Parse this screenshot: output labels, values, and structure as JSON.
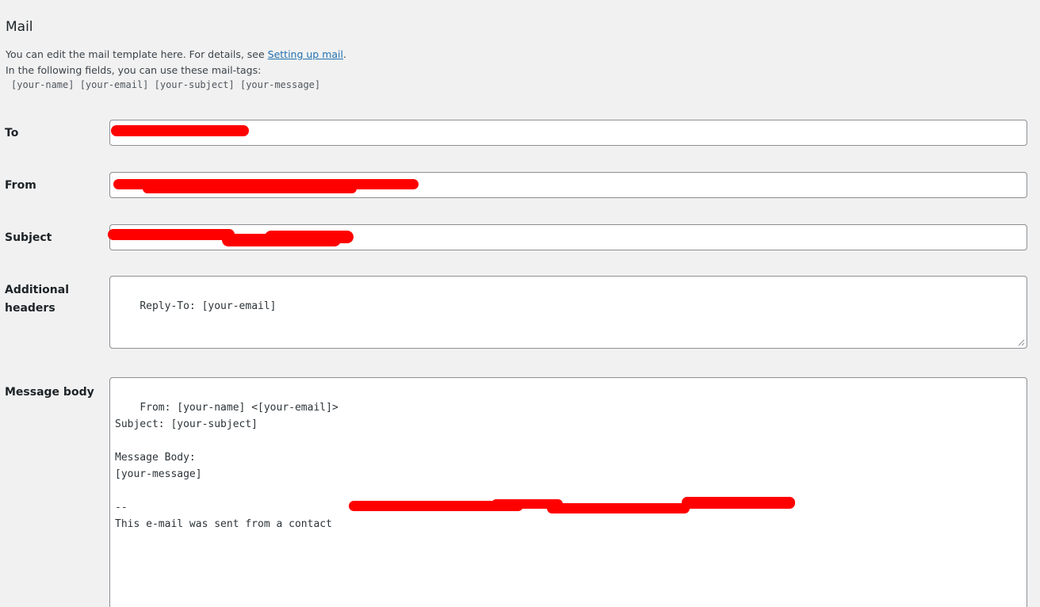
{
  "section": {
    "title": "Mail",
    "desc_line1_prefix": "You can edit the mail template here. For details, see ",
    "desc_link": "Setting up mail",
    "desc_line1_suffix": ".",
    "desc_line2": "In the following fields, you can use these mail-tags:",
    "mail_tags": "[your-name] [your-email] [your-subject] [your-message]"
  },
  "fields": {
    "to": {
      "label": "To",
      "value": ""
    },
    "from": {
      "label": "From",
      "value": ""
    },
    "subject": {
      "label": "Subject",
      "value": ""
    },
    "additional_headers": {
      "label_line1": "Additional",
      "label_line2": "headers",
      "value": "Reply-To: [your-email]"
    },
    "message_body": {
      "label": "Message body",
      "value": "From: [your-name] <[your-email]>\nSubject: [your-subject]\n\nMessage Body:\n[your-message]\n\n--\nThis e-mail was sent from a contact"
    }
  },
  "colors": {
    "background": "#f1f1f1",
    "link": "#2271b1",
    "redaction": "#ff0000"
  }
}
